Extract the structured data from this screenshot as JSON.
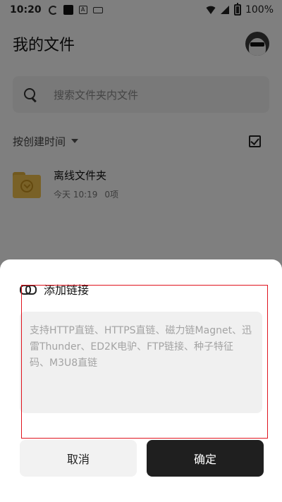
{
  "status_bar": {
    "time": "10:20",
    "battery": "100%"
  },
  "header": {
    "title": "我的文件"
  },
  "search": {
    "placeholder": "搜索文件夹内文件"
  },
  "sort": {
    "label": "按创建时间"
  },
  "files": [
    {
      "name": "离线文件夹",
      "date": "今天 10:19",
      "count": "0项"
    }
  ],
  "dialog": {
    "title": "添加链接",
    "input_placeholder": "支持HTTP直链、HTTPS直链、磁力链Magnet、迅雷Thunder、ED2K电驴、FTP链接、种子特征码、M3U8直链",
    "input_value": "",
    "cancel_label": "取消",
    "confirm_label": "确定"
  },
  "icons": {
    "search": "search-icon",
    "link": "link-icon",
    "folder": "download-folder-icon",
    "select_all": "checkbox-icon",
    "avatar": "avatar"
  },
  "colors": {
    "confirm_button": "#1f1f1f",
    "folder": "#f3c34e",
    "highlight": "#e0141e"
  }
}
